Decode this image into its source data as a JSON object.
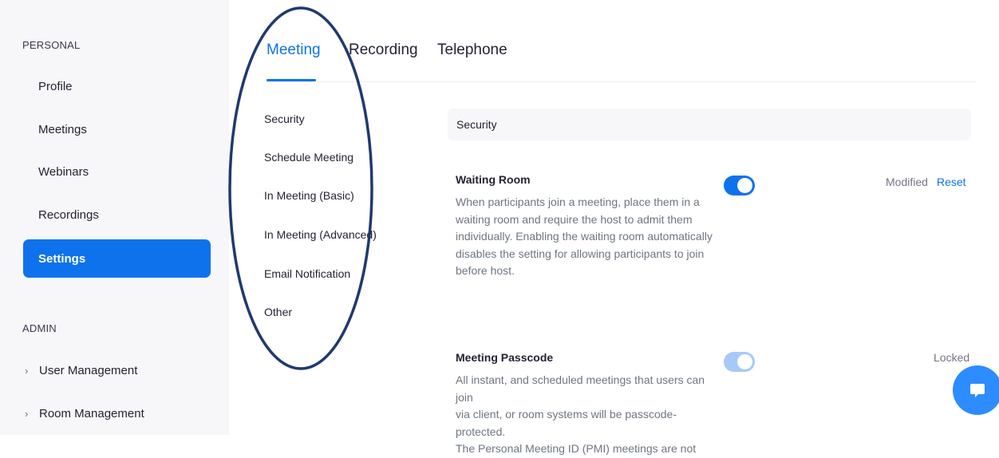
{
  "sidebar": {
    "personal_label": "PERSONAL",
    "items": [
      {
        "label": "Profile"
      },
      {
        "label": "Meetings"
      },
      {
        "label": "Webinars"
      },
      {
        "label": "Recordings"
      },
      {
        "label": "Settings"
      }
    ],
    "admin_label": "ADMIN",
    "admin_items": [
      {
        "label": "User Management"
      },
      {
        "label": "Room Management"
      }
    ]
  },
  "tabs": [
    {
      "label": "Meeting"
    },
    {
      "label": "Recording"
    },
    {
      "label": "Telephone"
    }
  ],
  "subnav": [
    {
      "label": "Security"
    },
    {
      "label": "Schedule Meeting"
    },
    {
      "label": "In Meeting (Basic)"
    },
    {
      "label": "In Meeting (Advanced)"
    },
    {
      "label": "Email Notification"
    },
    {
      "label": "Other"
    }
  ],
  "section_header": "Security",
  "settings": [
    {
      "title": "Waiting Room",
      "desc_lines": [
        "When participants join a meeting, place them in a",
        "waiting room and require the host to admit them",
        "individually. Enabling the waiting room automatically",
        "disables the setting for allowing participants to join",
        "before host."
      ],
      "status": "Modified",
      "action": "Reset"
    },
    {
      "title": "Meeting Passcode",
      "desc_lines": [
        "All instant, and scheduled meetings that users can join",
        "via client, or room systems will be passcode-protected.",
        "The Personal Meeting ID (PMI) meetings are not"
      ],
      "status": "Locked"
    }
  ],
  "colors": {
    "accent": "#0e72ed",
    "annotation": "#1f3a6e"
  },
  "icons": {
    "admin_chevron": "chevron-right-icon",
    "chat": "chat-icon"
  }
}
